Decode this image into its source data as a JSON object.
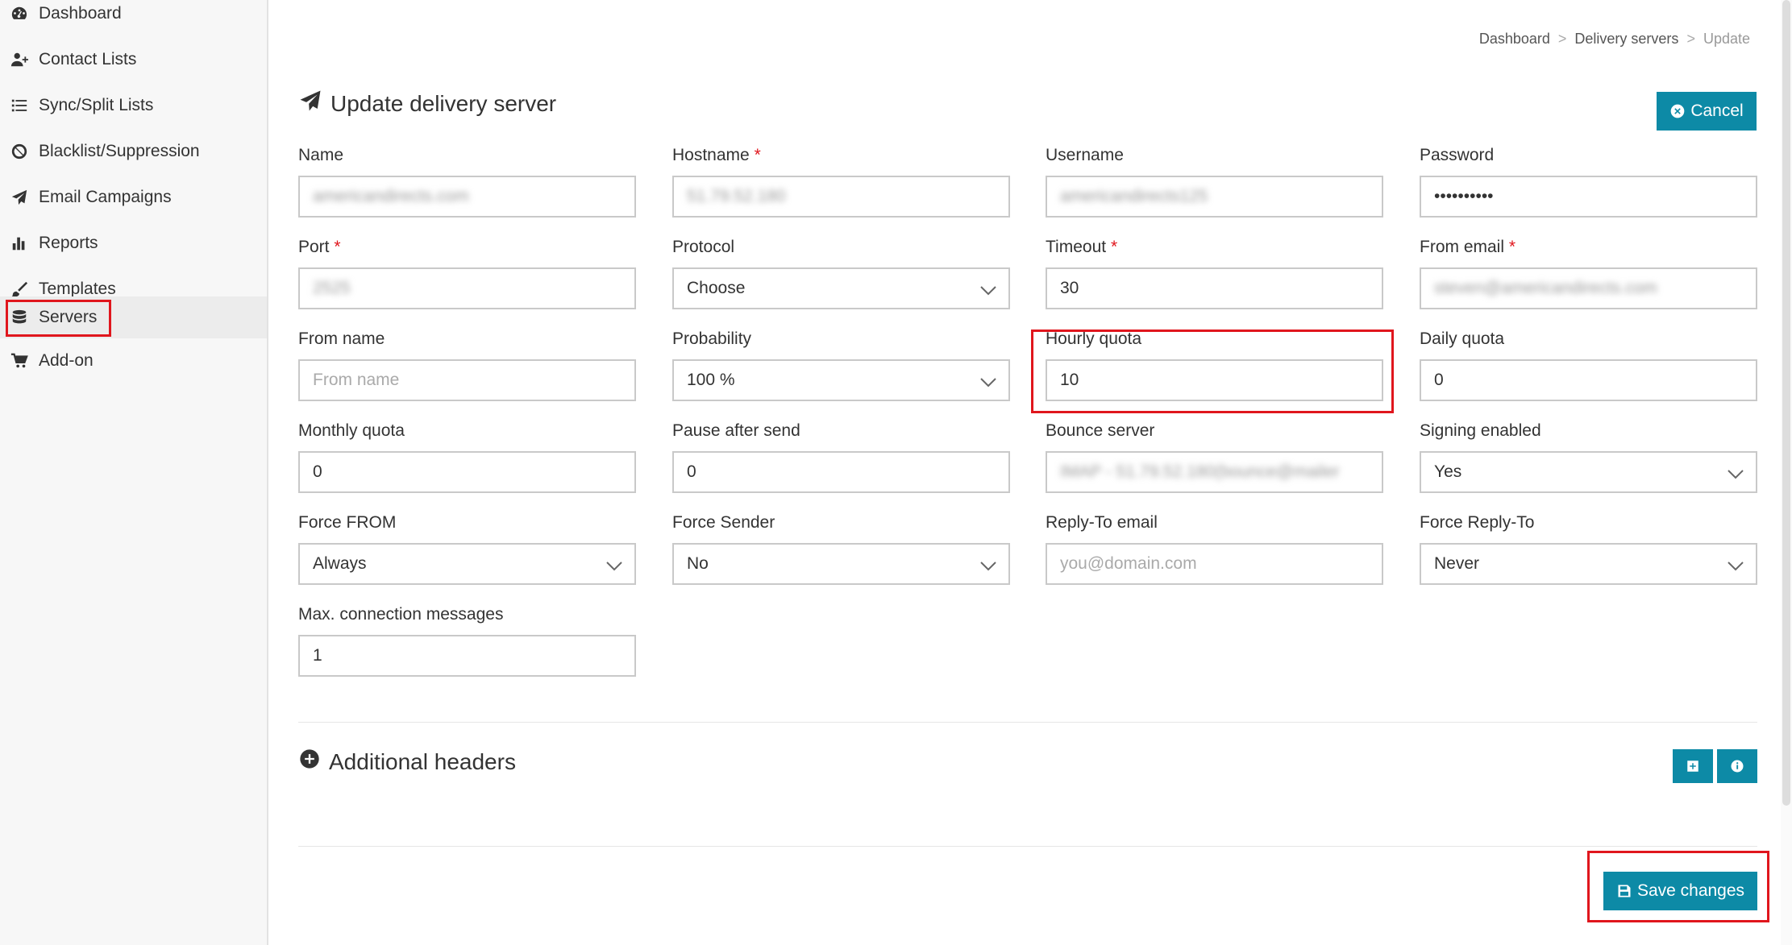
{
  "sidebar": {
    "items": [
      {
        "label": "Dashboard",
        "icon": "dashboard-icon"
      },
      {
        "label": "Contact Lists",
        "icon": "user-plus-icon"
      },
      {
        "label": "Sync/Split Lists",
        "icon": "list-icon"
      },
      {
        "label": "Blacklist/Suppression",
        "icon": "ban-icon"
      },
      {
        "label": "Email Campaigns",
        "icon": "paper-plane-icon"
      },
      {
        "label": "Reports",
        "icon": "bar-chart-icon"
      },
      {
        "label": "Templates",
        "icon": "brush-icon"
      },
      {
        "label": "Servers",
        "icon": "database-icon",
        "active": true
      },
      {
        "label": "Add-on",
        "icon": "cart-icon"
      }
    ]
  },
  "breadcrumb": {
    "items": [
      "Dashboard",
      "Delivery servers",
      "Update"
    ],
    "separator": ">"
  },
  "page": {
    "title": "Update delivery server"
  },
  "buttons": {
    "cancel": "Cancel",
    "save": "Save changes"
  },
  "form": {
    "name": {
      "label": "Name",
      "value": "americandirects.com"
    },
    "hostname": {
      "label": "Hostname",
      "value": "51.79.52.180"
    },
    "username": {
      "label": "Username",
      "value": "americandirects125"
    },
    "password": {
      "label": "Password",
      "value": "••••••••••"
    },
    "port": {
      "label": "Port",
      "value": "2525"
    },
    "protocol": {
      "label": "Protocol",
      "value": "Choose"
    },
    "timeout": {
      "label": "Timeout",
      "value": "30"
    },
    "from_email": {
      "label": "From email",
      "value": "steven@americandirects.com"
    },
    "from_name": {
      "label": "From name",
      "placeholder": "From name"
    },
    "probability": {
      "label": "Probability",
      "value": "100 %"
    },
    "hourly_quota": {
      "label": "Hourly quota",
      "value": "10"
    },
    "daily_quota": {
      "label": "Daily quota",
      "value": "0"
    },
    "monthly_quota": {
      "label": "Monthly quota",
      "value": "0"
    },
    "pause_after_send": {
      "label": "Pause after send",
      "value": "0"
    },
    "bounce_server": {
      "label": "Bounce server",
      "value": "IMAP - 51.79.52.180(bounce@mailer"
    },
    "signing_enabled": {
      "label": "Signing enabled",
      "value": "Yes"
    },
    "force_from": {
      "label": "Force FROM",
      "value": "Always"
    },
    "force_sender": {
      "label": "Force Sender",
      "value": "No"
    },
    "reply_to_email": {
      "label": "Reply-To email",
      "placeholder": "you@domain.com"
    },
    "force_reply_to": {
      "label": "Force Reply-To",
      "value": "Never"
    },
    "max_connection_messages": {
      "label": "Max. connection messages",
      "value": "1"
    }
  },
  "additional_headers": {
    "title": "Additional headers"
  },
  "required_marker": "*",
  "colors": {
    "accent": "#0d8aa6",
    "highlight": "#e0161d",
    "required": "#e0161d"
  }
}
